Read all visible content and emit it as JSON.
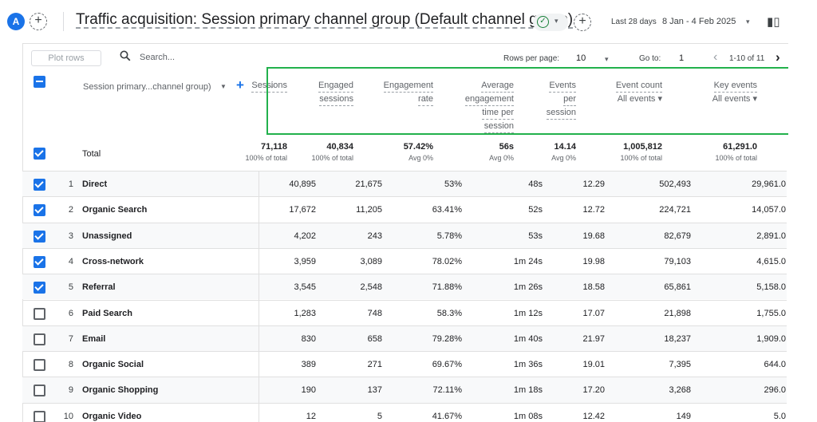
{
  "header": {
    "avatar_letter": "A",
    "add_label": "+",
    "title": "Traffic acquisition: Session primary channel group (Default channel group)",
    "date_label": "Last 28 days",
    "date_range": "8 Jan - 4 Feb 2025"
  },
  "toolbar": {
    "plot_rows": "Plot rows",
    "search_placeholder": "Search...",
    "rows_per_page_label": "Rows per page:",
    "rows_per_page": "10",
    "goto_label": "Go to:",
    "goto_value": "1",
    "page_info": "1-10 of 11"
  },
  "table": {
    "dimension_header": "Session primary...channel group)",
    "columns": [
      {
        "key": "sessions",
        "lines": [
          "Sessions"
        ]
      },
      {
        "key": "engaged",
        "lines": [
          "Engaged",
          "sessions"
        ]
      },
      {
        "key": "rate",
        "lines": [
          "Engagement",
          "rate"
        ]
      },
      {
        "key": "avg",
        "lines": [
          "Average",
          "engagement",
          "time per",
          "session"
        ]
      },
      {
        "key": "eps",
        "lines": [
          "Events",
          "per",
          "session"
        ]
      },
      {
        "key": "events",
        "lines": [
          "Event count"
        ],
        "sub": "All events"
      },
      {
        "key": "keyev",
        "lines": [
          "Key events"
        ],
        "sub": "All events"
      }
    ],
    "total": {
      "label": "Total",
      "values": [
        "71,118",
        "40,834",
        "57.42%",
        "56s",
        "14.14",
        "1,005,812",
        "61,291.0"
      ],
      "subs": [
        "100% of total",
        "100% of total",
        "Avg 0%",
        "Avg 0%",
        "Avg 0%",
        "100% of total",
        "100% of total"
      ]
    },
    "rows": [
      {
        "idx": "1",
        "name": "Direct",
        "checked": true,
        "values": [
          "40,895",
          "21,675",
          "53%",
          "48s",
          "12.29",
          "502,493",
          "29,961.0"
        ]
      },
      {
        "idx": "2",
        "name": "Organic Search",
        "checked": true,
        "values": [
          "17,672",
          "11,205",
          "63.41%",
          "52s",
          "12.72",
          "224,721",
          "14,057.0"
        ]
      },
      {
        "idx": "3",
        "name": "Unassigned",
        "checked": true,
        "values": [
          "4,202",
          "243",
          "5.78%",
          "53s",
          "19.68",
          "82,679",
          "2,891.0"
        ]
      },
      {
        "idx": "4",
        "name": "Cross-network",
        "checked": true,
        "values": [
          "3,959",
          "3,089",
          "78.02%",
          "1m 24s",
          "19.98",
          "79,103",
          "4,615.0"
        ]
      },
      {
        "idx": "5",
        "name": "Referral",
        "checked": true,
        "values": [
          "3,545",
          "2,548",
          "71.88%",
          "1m 26s",
          "18.58",
          "65,861",
          "5,158.0"
        ]
      },
      {
        "idx": "6",
        "name": "Paid Search",
        "checked": false,
        "values": [
          "1,283",
          "748",
          "58.3%",
          "1m 12s",
          "17.07",
          "21,898",
          "1,755.0"
        ]
      },
      {
        "idx": "7",
        "name": "Email",
        "checked": false,
        "values": [
          "830",
          "658",
          "79.28%",
          "1m 40s",
          "21.97",
          "18,237",
          "1,909.0"
        ]
      },
      {
        "idx": "8",
        "name": "Organic Social",
        "checked": false,
        "values": [
          "389",
          "271",
          "69.67%",
          "1m 36s",
          "19.01",
          "7,395",
          "644.0"
        ]
      },
      {
        "idx": "9",
        "name": "Organic Shopping",
        "checked": false,
        "values": [
          "190",
          "137",
          "72.11%",
          "1m 18s",
          "17.20",
          "3,268",
          "296.0"
        ]
      },
      {
        "idx": "10",
        "name": "Organic Video",
        "checked": false,
        "values": [
          "12",
          "5",
          "41.67%",
          "1m 08s",
          "12.42",
          "149",
          "5.0"
        ]
      }
    ]
  },
  "colors": {
    "accent": "#1a73e8",
    "highlight": "#22b14c"
  }
}
